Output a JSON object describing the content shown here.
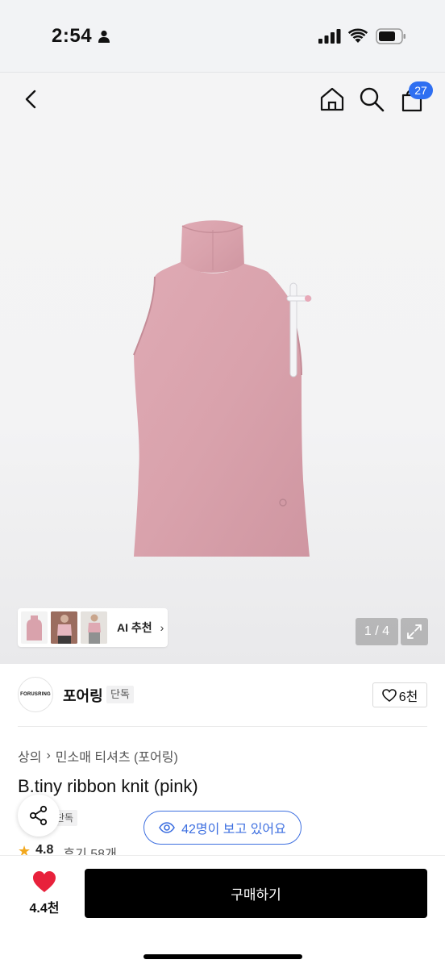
{
  "status_bar": {
    "time": "2:54"
  },
  "nav": {
    "cart_badge": "27"
  },
  "gallery": {
    "ai_recommend_label": "AI 추천",
    "page_counter": "1 / 4"
  },
  "brand": {
    "logo_text": "FORUSRING",
    "name": "포어링",
    "tag": "단독",
    "like_count": "6천"
  },
  "breadcrumb": {
    "items": [
      "상의",
      "민소매 티셔츠 (포어링)"
    ]
  },
  "product": {
    "title": "B.tiny ribbon knit (pink)",
    "exclusive_tag": "단독",
    "rating": "4.8",
    "review_label": "후기 58개"
  },
  "viewers": {
    "text": "42명이 보고 있어요"
  },
  "bottom_bar": {
    "favorite_count": "4.4천",
    "buy_label": "구매하기"
  },
  "colors": {
    "accent_blue": "#2f6ff1",
    "heart_red": "#e8213b",
    "product_pink": "#d7a3ad",
    "buy_button": "#000000"
  }
}
